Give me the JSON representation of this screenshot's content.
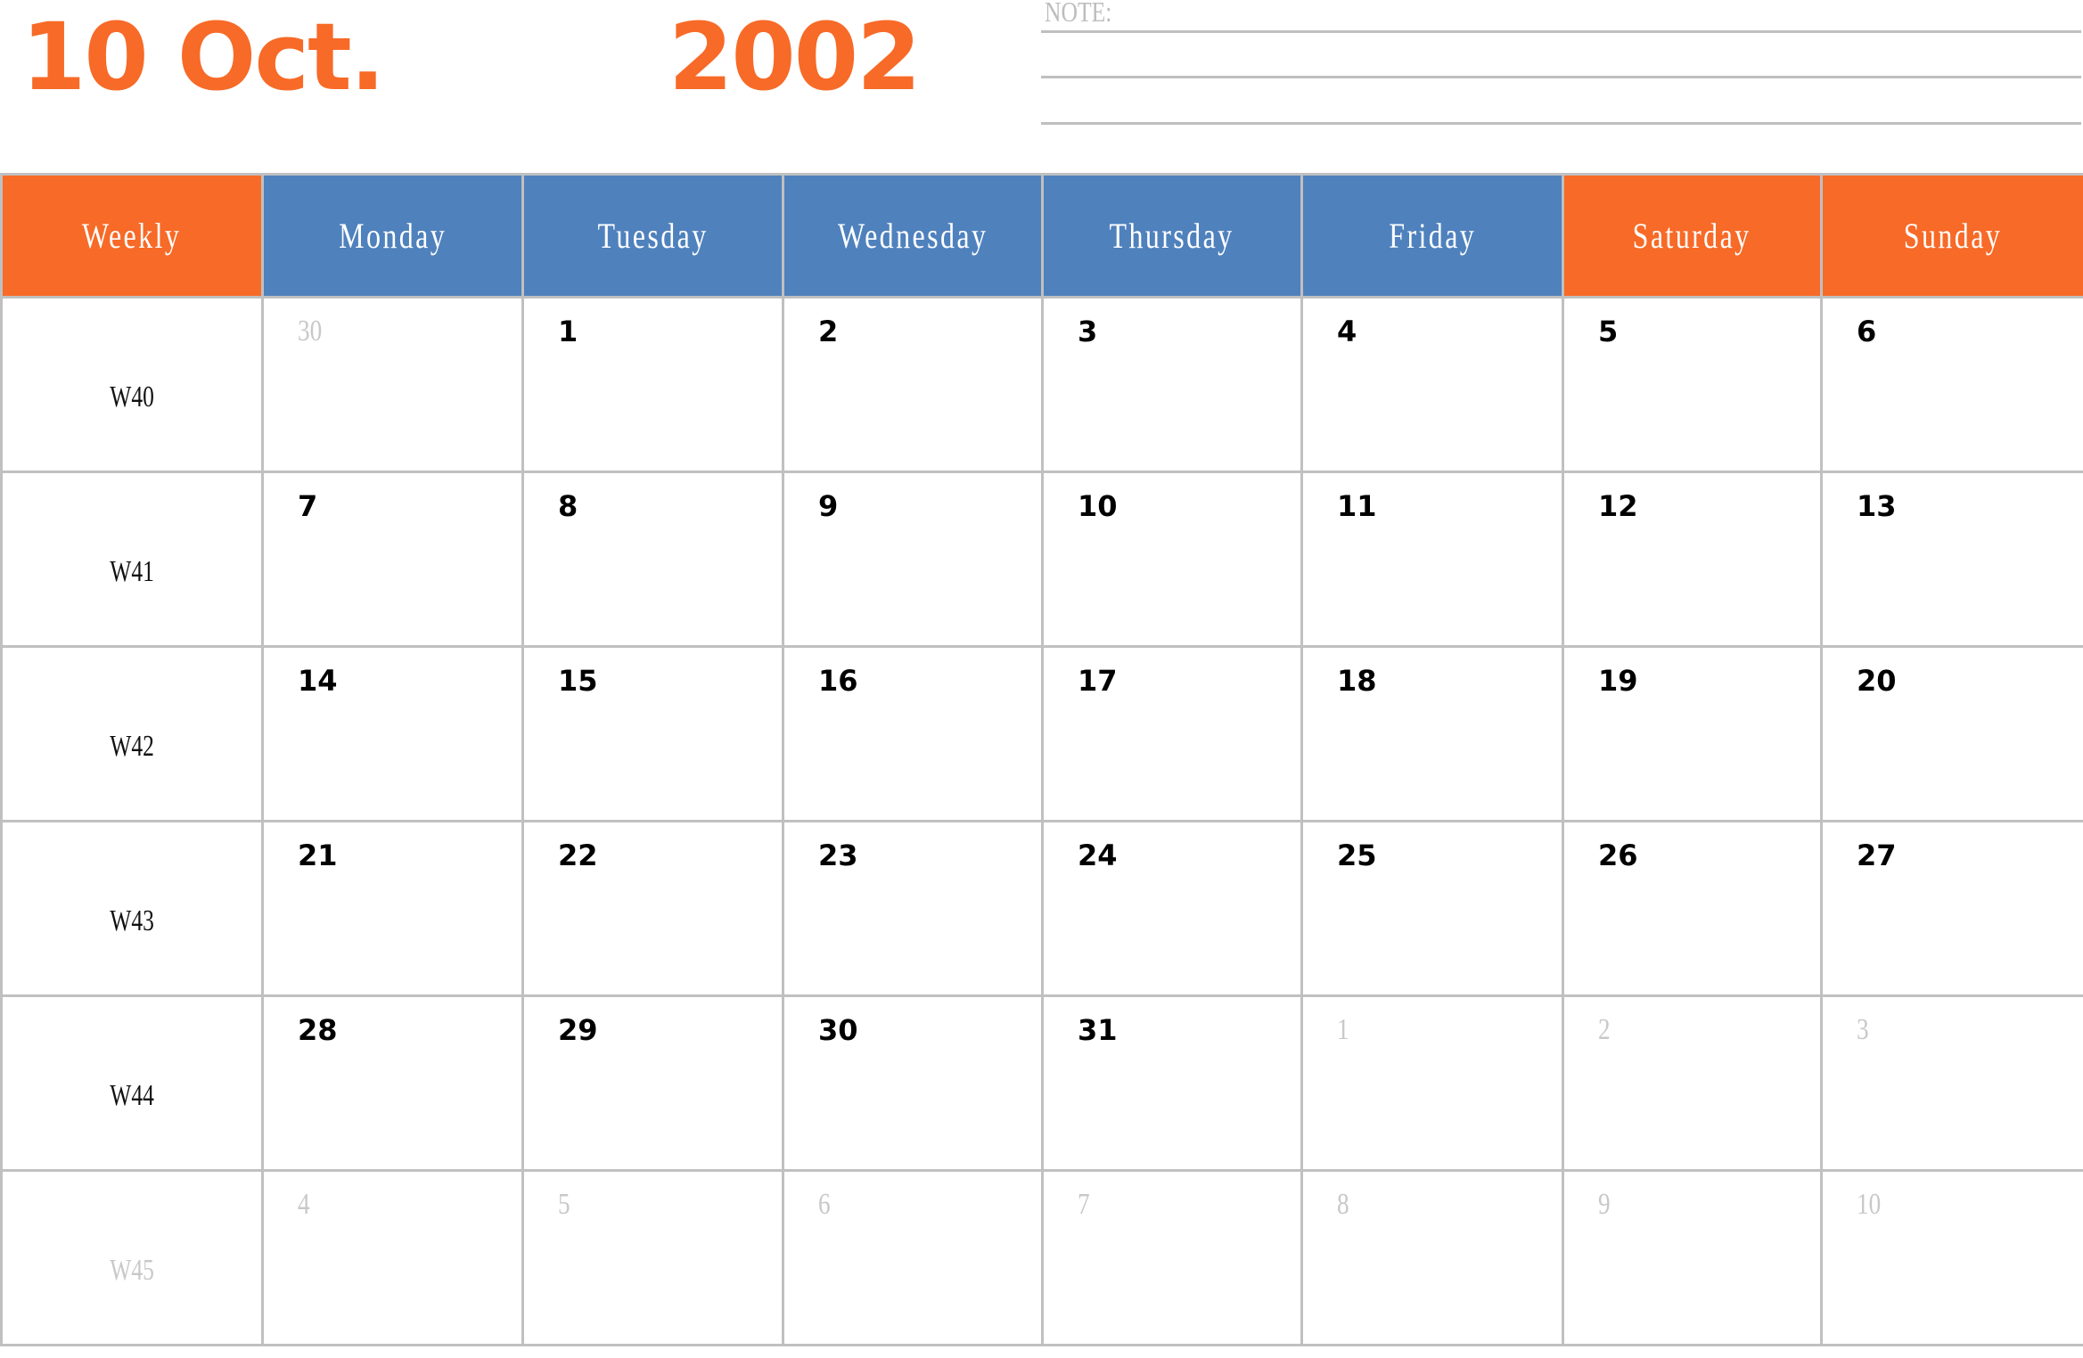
{
  "header": {
    "date_title": "10 Oct.",
    "year": "2002",
    "note_label": "NOTE:"
  },
  "colors": {
    "accent_orange": "#F76A27",
    "weekday_blue": "#4F81BD",
    "grid_gray": "#C0C0C0",
    "faded_text": "#C8C8C8"
  },
  "columns": [
    "Weekly",
    "Monday",
    "Tuesday",
    "Wednesday",
    "Thursday",
    "Friday",
    "Saturday",
    "Sunday"
  ],
  "weeks": [
    {
      "label": "W40",
      "faded": false,
      "days": [
        {
          "n": "30",
          "faded": true
        },
        {
          "n": "1",
          "faded": false
        },
        {
          "n": "2",
          "faded": false
        },
        {
          "n": "3",
          "faded": false
        },
        {
          "n": "4",
          "faded": false
        },
        {
          "n": "5",
          "faded": false
        },
        {
          "n": "6",
          "faded": false
        }
      ]
    },
    {
      "label": "W41",
      "faded": false,
      "days": [
        {
          "n": "7",
          "faded": false
        },
        {
          "n": "8",
          "faded": false
        },
        {
          "n": "9",
          "faded": false
        },
        {
          "n": "10",
          "faded": false
        },
        {
          "n": "11",
          "faded": false
        },
        {
          "n": "12",
          "faded": false
        },
        {
          "n": "13",
          "faded": false
        }
      ]
    },
    {
      "label": "W42",
      "faded": false,
      "days": [
        {
          "n": "14",
          "faded": false
        },
        {
          "n": "15",
          "faded": false
        },
        {
          "n": "16",
          "faded": false
        },
        {
          "n": "17",
          "faded": false
        },
        {
          "n": "18",
          "faded": false
        },
        {
          "n": "19",
          "faded": false
        },
        {
          "n": "20",
          "faded": false
        }
      ]
    },
    {
      "label": "W43",
      "faded": false,
      "days": [
        {
          "n": "21",
          "faded": false
        },
        {
          "n": "22",
          "faded": false
        },
        {
          "n": "23",
          "faded": false
        },
        {
          "n": "24",
          "faded": false
        },
        {
          "n": "25",
          "faded": false
        },
        {
          "n": "26",
          "faded": false
        },
        {
          "n": "27",
          "faded": false
        }
      ]
    },
    {
      "label": "W44",
      "faded": false,
      "days": [
        {
          "n": "28",
          "faded": false
        },
        {
          "n": "29",
          "faded": false
        },
        {
          "n": "30",
          "faded": false
        },
        {
          "n": "31",
          "faded": false
        },
        {
          "n": "1",
          "faded": true
        },
        {
          "n": "2",
          "faded": true
        },
        {
          "n": "3",
          "faded": true
        }
      ]
    },
    {
      "label": "W45",
      "faded": true,
      "days": [
        {
          "n": "4",
          "faded": true
        },
        {
          "n": "5",
          "faded": true
        },
        {
          "n": "6",
          "faded": true
        },
        {
          "n": "7",
          "faded": true
        },
        {
          "n": "8",
          "faded": true
        },
        {
          "n": "9",
          "faded": true
        },
        {
          "n": "10",
          "faded": true
        }
      ]
    }
  ]
}
